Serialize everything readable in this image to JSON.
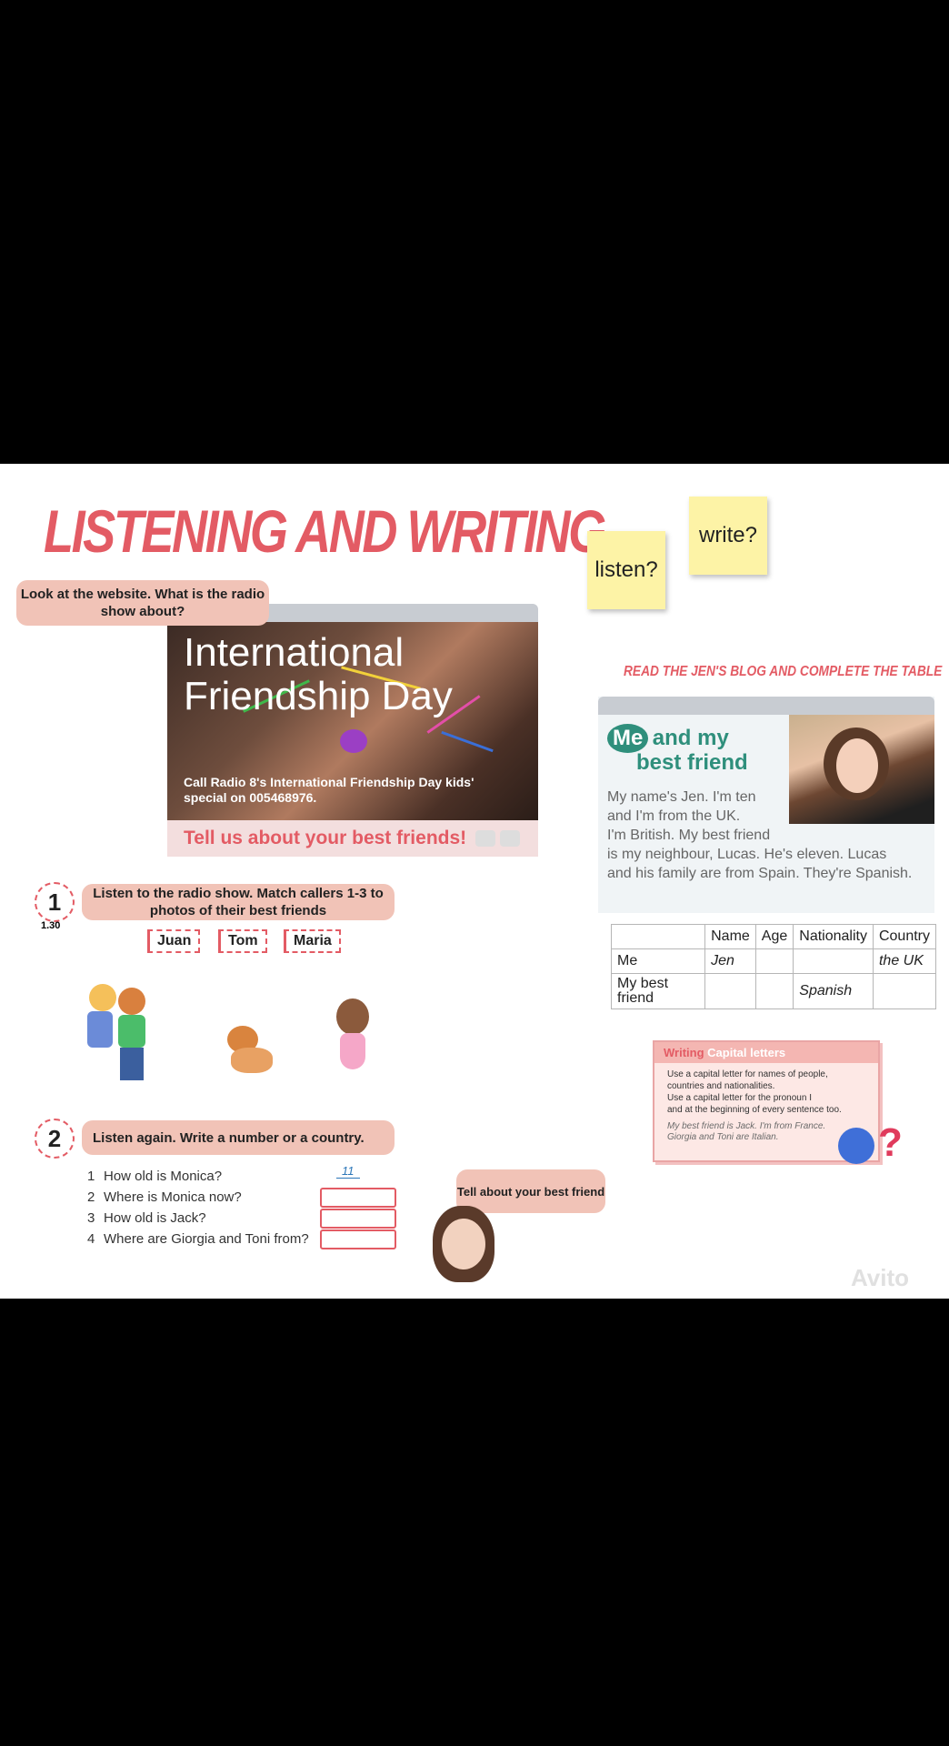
{
  "title": "LISTENING AND WRITING",
  "sticky_notes": {
    "listen": "listen?",
    "write": "write?"
  },
  "look_bubble": "Look at the website. What is the radio show about?",
  "website": {
    "title_line1": "International",
    "title_line2": "Friendship Day",
    "subtitle": "Call Radio 8's International Friendship Day kids' special on 005468976.",
    "tell_us": "Tell us about your best friends!"
  },
  "exercise1": {
    "number": "1",
    "track": "1.30",
    "instruction": "Listen to the radio show. Match callers 1-3 to photos of their best friends",
    "names": [
      "Juan",
      "Tom",
      "Maria"
    ]
  },
  "exercise2": {
    "number": "2",
    "instruction": "Listen again. Write a number or a country.",
    "questions": [
      {
        "n": "1",
        "text": "How old is Monica?",
        "answer": "11"
      },
      {
        "n": "2",
        "text": "Where is Monica now?",
        "answer": ""
      },
      {
        "n": "3",
        "text": "How old is Jack?",
        "answer": ""
      },
      {
        "n": "4",
        "text": "Where are Giorgia and Toni from?",
        "answer": ""
      }
    ]
  },
  "tell_bubble": "Tell about your best friend",
  "blog": {
    "heading": "READ THE JEN'S BLOG AND COMPLETE THE TABLE",
    "logo_me": "Me",
    "logo_rest1": "and my",
    "logo_rest2": "best friend",
    "text_lines": [
      "My name's Jen. I'm ten",
      "and I'm from the UK.",
      "I'm British. My best friend",
      "is my neighbour, Lucas. He's eleven. Lucas",
      "and his family are from Spain. They're Spanish."
    ]
  },
  "table": {
    "headers": [
      "",
      "Name",
      "Age",
      "Nationality",
      "Country"
    ],
    "rows": [
      [
        "Me",
        "Jen",
        "",
        "",
        "the UK"
      ],
      [
        "My best friend",
        "",
        "",
        "Spanish",
        ""
      ]
    ]
  },
  "writing": {
    "label": "Writing",
    "topic": "Capital letters",
    "rules": [
      "Use a capital letter for names of people, countries and nationalities.",
      "Use a capital letter for the pronoun I",
      "and at the beginning of every sentence too."
    ],
    "examples": [
      "My best friend is Jack.    I'm from France.",
      "Giorgia and Toni are Italian."
    ]
  },
  "watermark": "Avito",
  "colors": {
    "accent": "#e35b64",
    "sticky": "#fdf3a6",
    "bubble": "#f1c3b7",
    "answer_blue": "#2b76b8"
  }
}
